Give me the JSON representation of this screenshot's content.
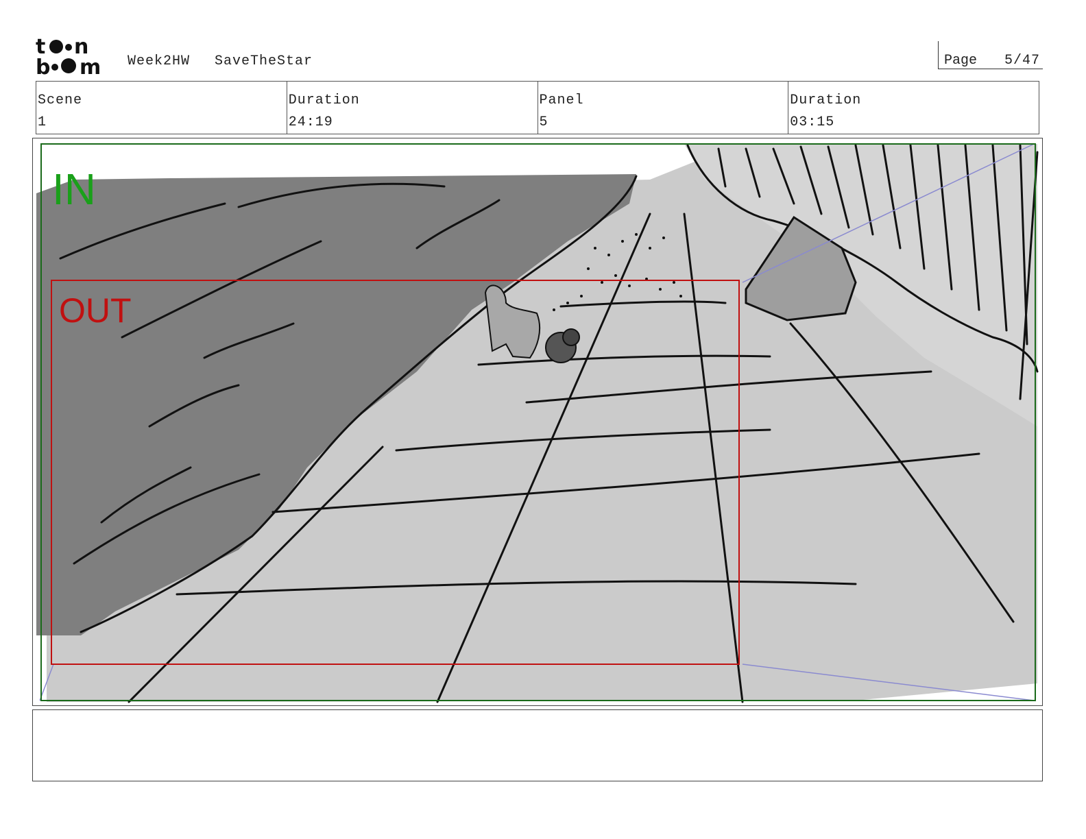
{
  "header": {
    "brand": "toon boom",
    "project": "Week2HW",
    "sequence": "SaveTheStar",
    "page_label": "Page",
    "page_number": "5/47"
  },
  "info": {
    "scene_label": "Scene",
    "scene_value": "1",
    "duration_label": "Duration",
    "duration_value": "24:19",
    "panel_label": "Panel",
    "panel_value": "5",
    "panel_duration_label": "Duration",
    "panel_duration_value": "03:15"
  },
  "panel": {
    "in_label": "IN",
    "out_label": "OUT",
    "in_color": "#1aa01a",
    "out_color": "#c01010"
  },
  "notes": {
    "text": ""
  }
}
